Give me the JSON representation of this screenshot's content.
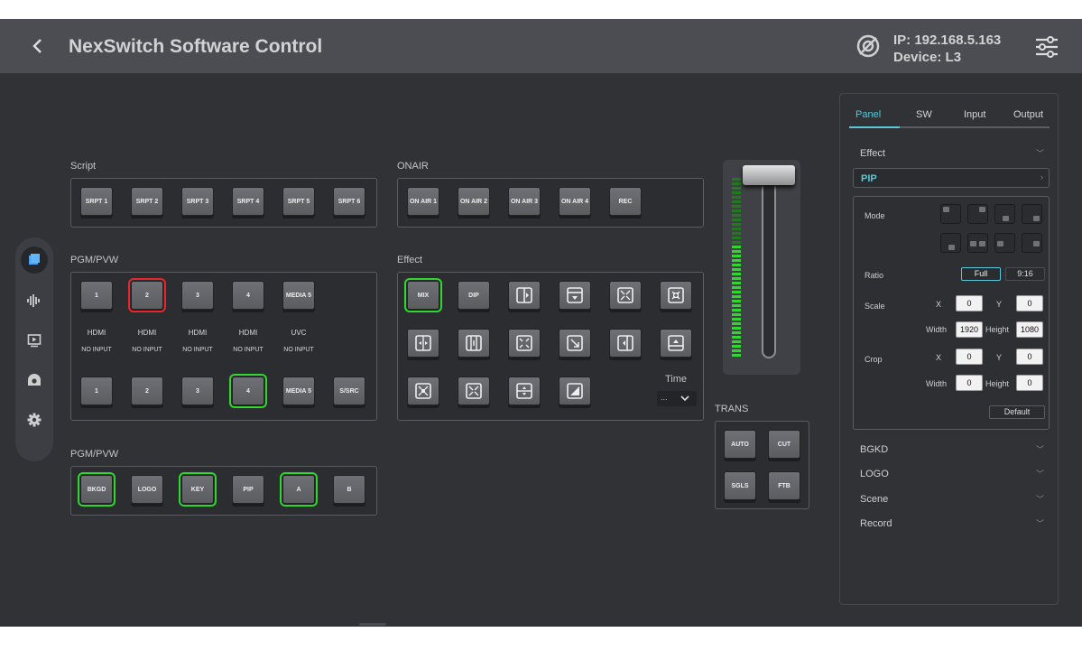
{
  "header": {
    "title": "NexSwitch Software Control",
    "ip": "IP: 192.168.5.163",
    "device": "Device: L3"
  },
  "sections": {
    "script": "Script",
    "onair": "ONAIR",
    "pgm1": "PGM/PVW",
    "effect": "Effect",
    "pgm2": "PGM/PVW",
    "trans": "TRANS",
    "time": "Time",
    "time_value": "..."
  },
  "script_buttons": [
    "SRPT 1",
    "SRPT 2",
    "SRPT 3",
    "SRPT 4",
    "SRPT 5",
    "SRPT 6"
  ],
  "onair_buttons": [
    "ON AIR 1",
    "ON AIR 2",
    "ON AIR 3",
    "ON AIR 4",
    "REC"
  ],
  "pgm_buttons": [
    "1",
    "2",
    "3",
    "4",
    "MEDIA 5"
  ],
  "pvw_buttons": [
    "1",
    "2",
    "3",
    "4",
    "MEDIA 5",
    "S/SRC"
  ],
  "source_types": [
    "HDMI",
    "HDMI",
    "HDMI",
    "HDMI",
    "UVC"
  ],
  "source_status": [
    "NO INPUT",
    "NO INPUT",
    "NO INPUT",
    "NO INPUT",
    "NO INPUT"
  ],
  "effect_buttons": {
    "mix": "MIX",
    "dip": "DIP"
  },
  "layer_buttons": [
    "BKGD",
    "LOGO",
    "KEY",
    "PIP",
    "A",
    "B"
  ],
  "trans_buttons": [
    "AUTO",
    "CUT",
    "SGLS",
    "FTB"
  ],
  "state": {
    "pgm_active": "2",
    "pvw_active": "4",
    "effect_active": "MIX",
    "layers_active": [
      "BKGD",
      "KEY",
      "A"
    ],
    "tbar_level": 0.0,
    "tbar_meter_level": 0.62
  },
  "colors": {
    "program": "#e8262b",
    "preview": "#2fd82c",
    "accent": "#5ac8d8"
  },
  "right_panel": {
    "tabs": [
      "Panel",
      "SW",
      "Input",
      "Output"
    ],
    "active_tab": "Panel",
    "effect": "Effect",
    "pip": "PIP",
    "mode_label": "Mode",
    "ratio_label": "Ratio",
    "ratio_options": [
      "Full",
      "9:16"
    ],
    "ratio_selected": "Full",
    "scale": {
      "label": "Scale",
      "x_label": "X",
      "x": "0",
      "y_label": "Y",
      "y": "0",
      "w_label": "Width",
      "w": "1920",
      "h_label": "Height",
      "h": "1080"
    },
    "crop": {
      "label": "Crop",
      "x_label": "X",
      "x": "0",
      "y_label": "Y",
      "y": "0",
      "w_label": "Width",
      "w": "0",
      "h_label": "Height",
      "h": "0"
    },
    "default_btn": "Default",
    "sections": [
      "BGKD",
      "LOGO",
      "Scene",
      "Record"
    ]
  },
  "icons": {
    "back": "back-arrow-icon",
    "connection": "connection-status-icon",
    "settings": "sliders-settings-icon",
    "rail": [
      "panel-icon",
      "audio-icon",
      "playback-icon",
      "camera-icon",
      "gear-icon"
    ]
  }
}
